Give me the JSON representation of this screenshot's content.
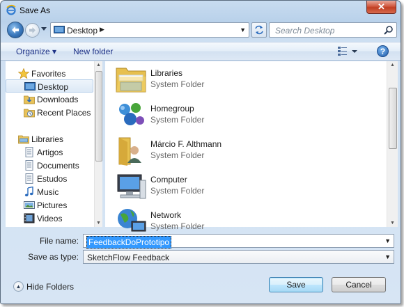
{
  "window": {
    "title": "Save As",
    "close_glyph": "✕"
  },
  "nav": {
    "address_path": "Desktop",
    "search_placeholder": "Search Desktop"
  },
  "toolbar": {
    "organize_label": "Organize ▾",
    "new_folder_label": "New folder",
    "help_glyph": "?"
  },
  "sidebar": {
    "favorites": {
      "label": "Favorites",
      "items": [
        {
          "label": "Desktop",
          "selected": true
        },
        {
          "label": "Downloads"
        },
        {
          "label": "Recent Places"
        }
      ]
    },
    "libraries": {
      "label": "Libraries",
      "items": [
        {
          "label": "Artigos"
        },
        {
          "label": "Documents"
        },
        {
          "label": "Estudos"
        },
        {
          "label": "Music"
        },
        {
          "label": "Pictures"
        },
        {
          "label": "Videos"
        }
      ]
    }
  },
  "files": [
    {
      "name": "Libraries",
      "type": "System Folder",
      "icon": "libraries-icon"
    },
    {
      "name": "Homegroup",
      "type": "System Folder",
      "icon": "homegroup-icon"
    },
    {
      "name": "Márcio F. Althmann",
      "type": "System Folder",
      "icon": "user-folder-icon"
    },
    {
      "name": "Computer",
      "type": "System Folder",
      "icon": "computer-icon"
    },
    {
      "name": "Network",
      "type": "System Folder",
      "icon": "network-icon"
    }
  ],
  "form": {
    "file_name_label": "File name:",
    "file_name_value": "FeedbackDoPrototipo",
    "save_type_label": "Save as type:",
    "save_type_value": "SketchFlow Feedback"
  },
  "footer": {
    "hide_folders_label": "Hide Folders",
    "save_label": "Save",
    "cancel_label": "Cancel"
  },
  "colors": {
    "selection": "#3399ff",
    "link": "#1e3287",
    "close": "#c13f22"
  }
}
